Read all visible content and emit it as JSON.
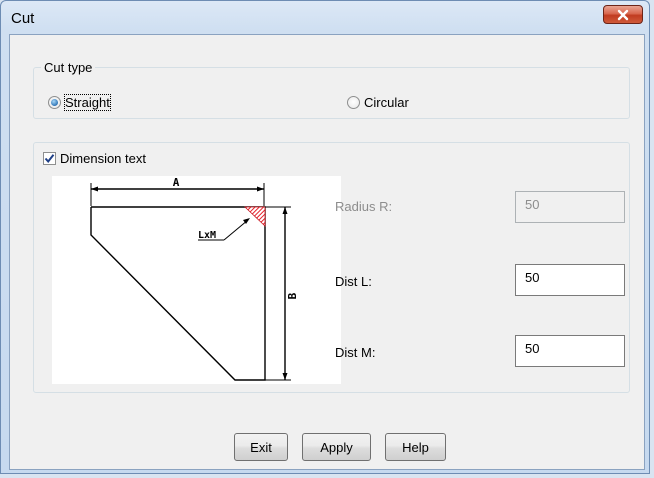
{
  "window": {
    "title": "Cut"
  },
  "cut_type": {
    "legend": "Cut type",
    "options": [
      {
        "label": "Straight",
        "selected": true
      },
      {
        "label": "Circular",
        "selected": false
      }
    ]
  },
  "dimension": {
    "checkbox_label": "Dimension text",
    "checked": true,
    "diagram_labels": {
      "a": "A",
      "b": "B",
      "lxm": "LxM"
    },
    "fields": {
      "radius": {
        "label": "Radius R:",
        "value": "50",
        "enabled": false
      },
      "dist_l": {
        "label": "Dist L:",
        "value": "50",
        "enabled": true
      },
      "dist_m": {
        "label": "Dist M:",
        "value": "50",
        "enabled": true
      }
    }
  },
  "buttons": {
    "exit": "Exit",
    "apply": "Apply",
    "help": "Help"
  },
  "colors": {
    "close_button": "#c13c21",
    "hatch": "#e8202a",
    "radio_dot": "#2f74b6"
  }
}
